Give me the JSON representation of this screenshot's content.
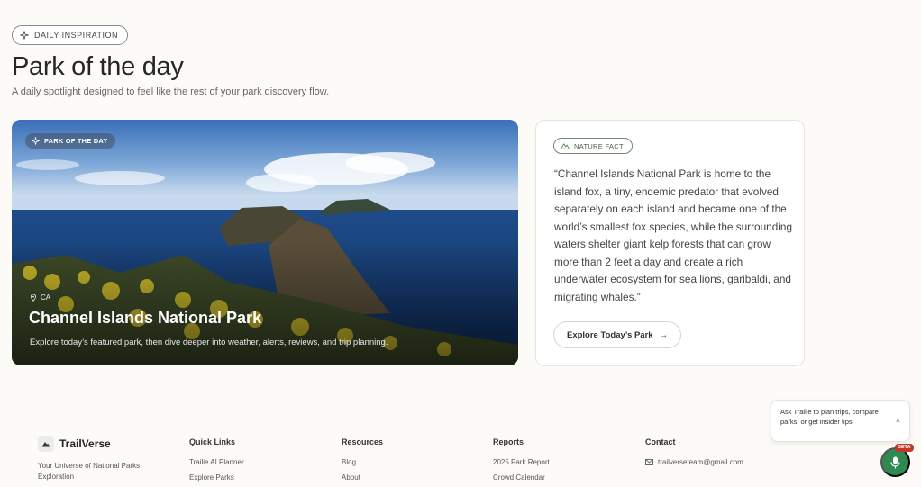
{
  "header": {
    "badge_label": "DAILY INSPIRATION",
    "title": "Park of the day",
    "subtitle": "A daily spotlight designed to feel like the rest of your park discovery flow."
  },
  "featured_park": {
    "badge_label": "PARK OF THE DAY",
    "state": "CA",
    "name": "Channel Islands National Park",
    "description": "Explore today’s featured park, then dive deeper into weather, alerts, reviews, and trip planning."
  },
  "fact_card": {
    "badge_label": "NATURE FACT",
    "text": "“Channel Islands National Park is home to the island fox, a tiny, endemic predator that evolved separately on each island and became one of the world’s smallest fox species, while the surrounding waters shelter giant kelp forests that can grow more than 2 feet a day and create a rich underwater ecosystem for sea lions, garibaldi, and migrating whales.”",
    "button_label": "Explore Today’s Park",
    "button_arrow": "→"
  },
  "footer": {
    "brand_name": "TrailVerse",
    "tagline": "Your Universe of National Parks Exploration",
    "quick_links": {
      "heading": "Quick Links",
      "items": [
        "Trailie AI Planner",
        "Explore Parks"
      ]
    },
    "resources": {
      "heading": "Resources",
      "items": [
        "Blog",
        "About"
      ]
    },
    "reports": {
      "heading": "Reports",
      "items": [
        "2025 Park Report",
        "Crowd Calendar"
      ]
    },
    "contact": {
      "heading": "Contact",
      "email": "trailverseteam@gmail.com"
    }
  },
  "chat": {
    "tip_text": "Ask Trailie to plan trips, compare parks, or get insider tips",
    "close_glyph": "×",
    "beta_label": "BETA"
  },
  "colors": {
    "page_bg": "#fcfbf7",
    "accent_green": "#2f8a52",
    "beta_red": "#c0392b"
  },
  "icons": {
    "badge": "sparkle-icon",
    "fact": "mountain-icon",
    "location": "map-pin-icon",
    "email": "mail-icon",
    "mic": "microphone-icon"
  }
}
